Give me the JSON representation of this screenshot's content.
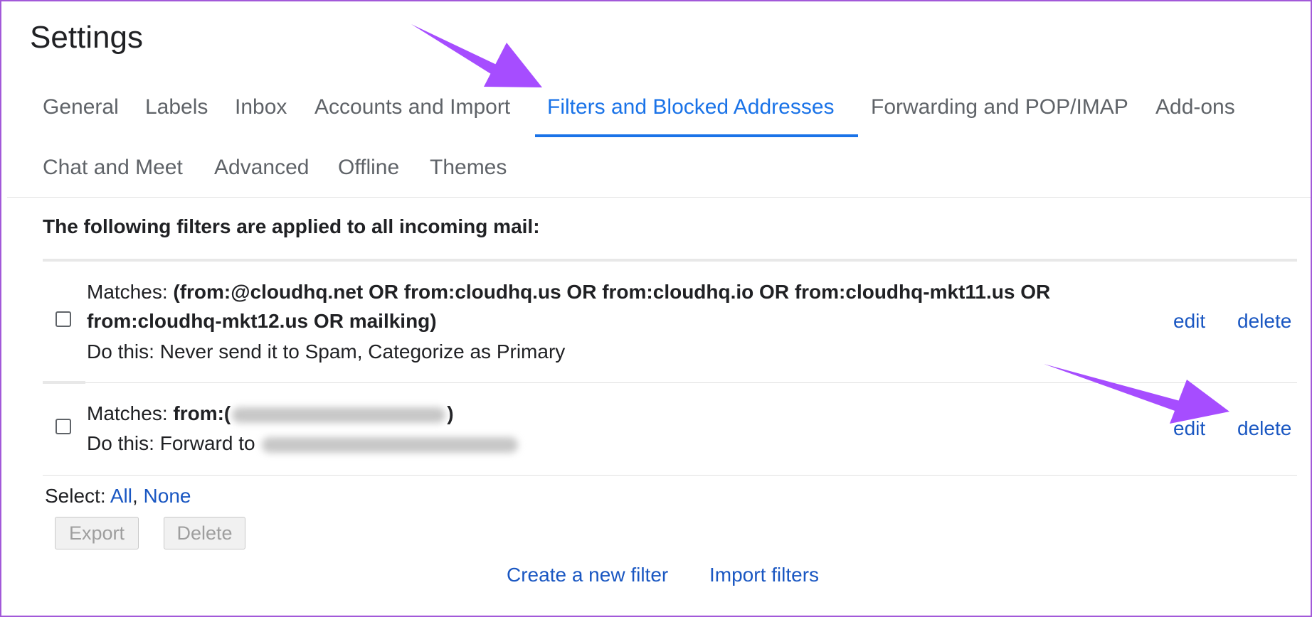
{
  "page_title": "Settings",
  "tabs": [
    {
      "label": "General",
      "active": false
    },
    {
      "label": "Labels",
      "active": false
    },
    {
      "label": "Inbox",
      "active": false
    },
    {
      "label": "Accounts and Import",
      "active": false
    },
    {
      "label": "Filters and Blocked Addresses",
      "active": true
    },
    {
      "label": "Forwarding and POP/IMAP",
      "active": false
    },
    {
      "label": "Add-ons",
      "active": false
    },
    {
      "label": "Chat and Meet",
      "active": false
    },
    {
      "label": "Advanced",
      "active": false
    },
    {
      "label": "Offline",
      "active": false
    },
    {
      "label": "Themes",
      "active": false
    }
  ],
  "filters_heading": "The following filters are applied to all incoming mail:",
  "filters": [
    {
      "matches_label": "Matches:",
      "criteria_line1": "(from:@cloudhq.net OR from:cloudhq.us OR from:cloudhq.io OR from:cloudhq-mkt11.us OR",
      "criteria_line2": "from:cloudhq-mkt12.us OR mailking)",
      "action_label": "Do this:",
      "action": "Never send it to Spam, Categorize as Primary",
      "edit_label": "edit",
      "delete_label": "delete"
    },
    {
      "matches_label": "Matches:",
      "criteria_prefix": "from:(",
      "criteria_suffix": ")",
      "action_label": "Do this:",
      "action": "Forward to",
      "edit_label": "edit",
      "delete_label": "delete"
    }
  ],
  "select": {
    "label": "Select:",
    "all": "All",
    "separator": ",",
    "none": "None"
  },
  "buttons": {
    "export": "Export",
    "delete": "Delete"
  },
  "footer": {
    "create_filter": "Create a new filter",
    "import_filters": "Import filters"
  },
  "colors": {
    "accent": "#1a73e8",
    "link": "#1a57c2",
    "annotation": "#a64dff",
    "frame": "#a259d9"
  }
}
